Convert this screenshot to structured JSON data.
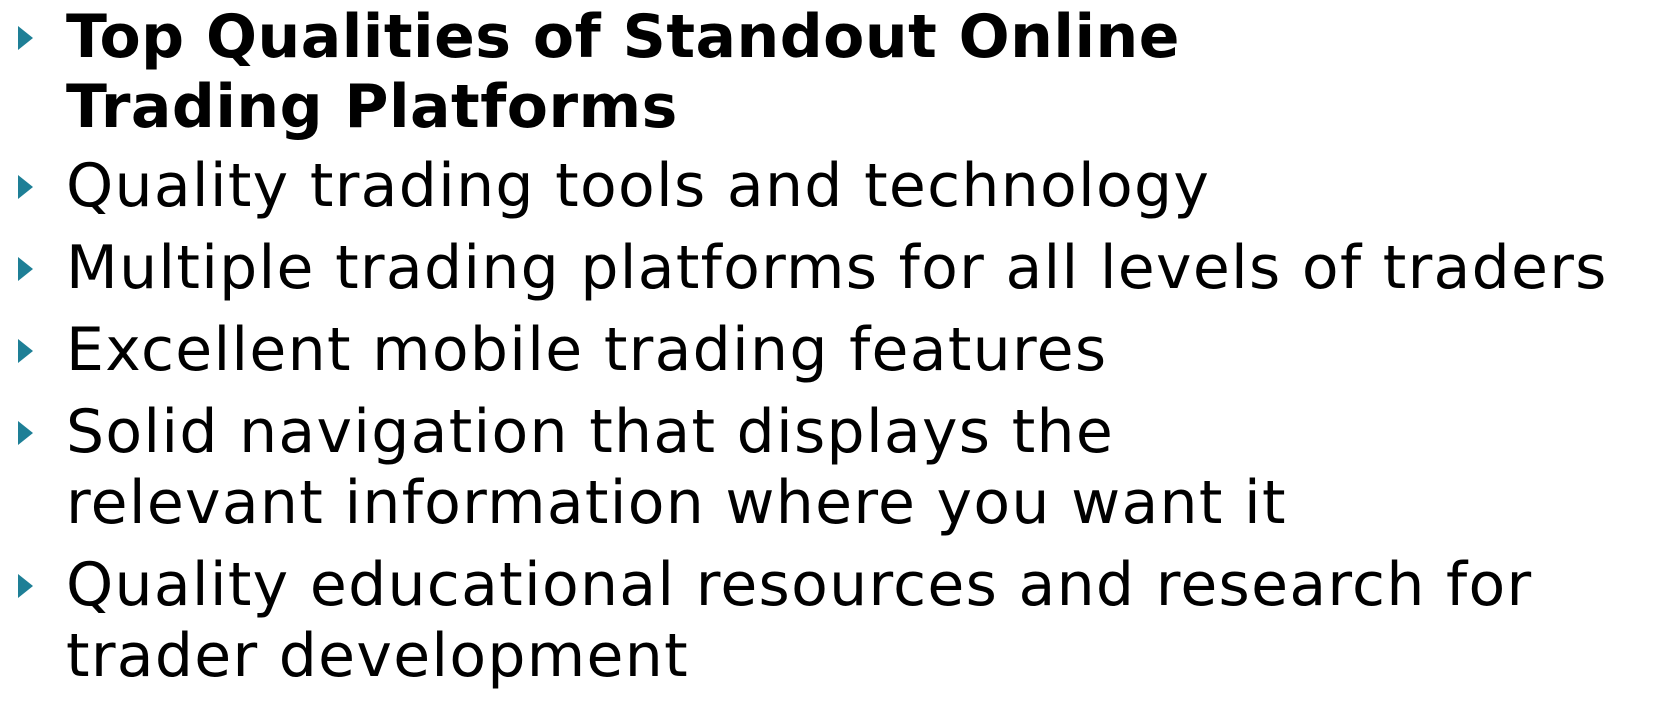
{
  "slide": {
    "bullet_icon": "triangle-right-icon",
    "bullet_color": "#1e7f96",
    "items": [
      {
        "text": "Top Qualities of Standout Online Trading Platforms",
        "bold": true
      },
      {
        "text": "Quality trading tools and technology"
      },
      {
        "text": "Multiple trading platforms for all levels of traders"
      },
      {
        "text": "Excellent mobile trading features"
      },
      {
        "text": "Solid navigation that displays the relevant information where you want it"
      },
      {
        "text": "Quality educational resources and research for trader development"
      }
    ]
  }
}
